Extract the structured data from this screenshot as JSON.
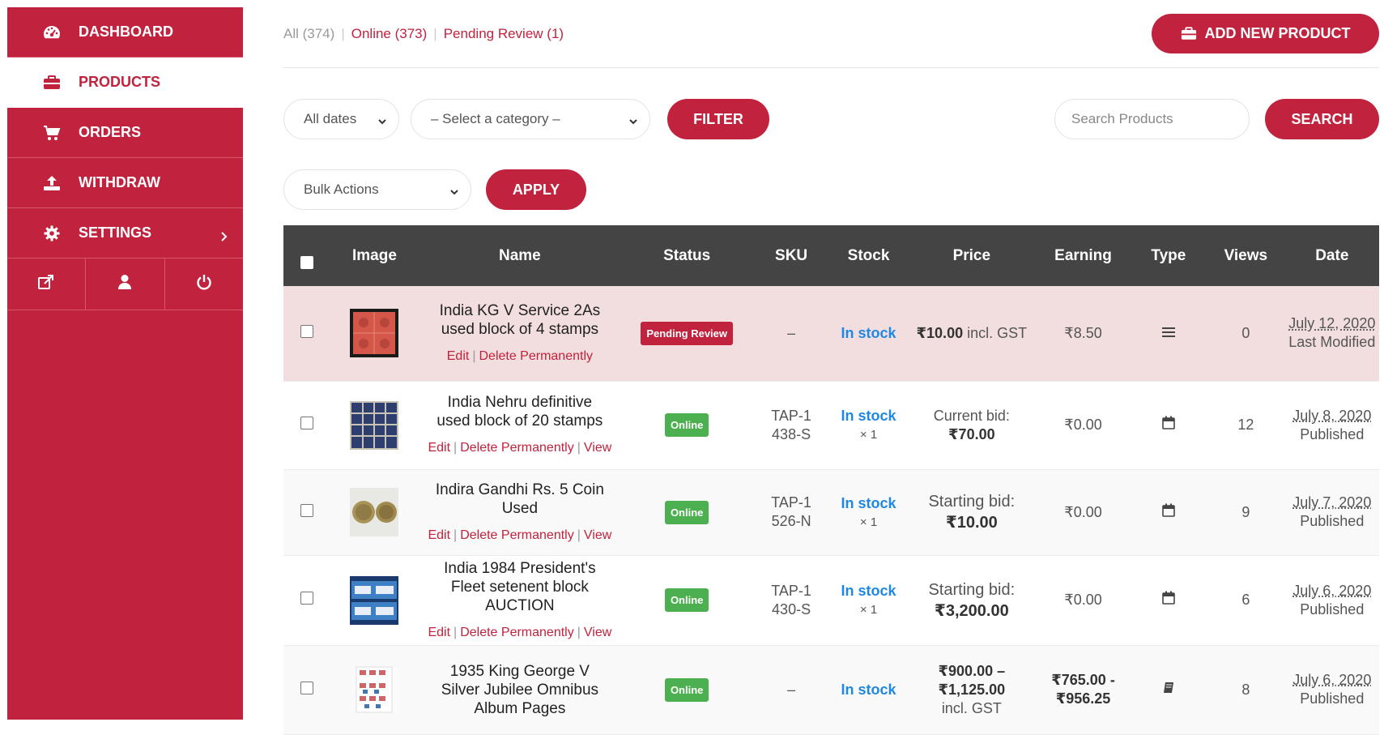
{
  "sidebar": {
    "items": [
      {
        "label": "DASHBOARD",
        "icon": "dashboard-icon"
      },
      {
        "label": "PRODUCTS",
        "icon": "briefcase-icon"
      },
      {
        "label": "ORDERS",
        "icon": "cart-icon"
      },
      {
        "label": "WITHDRAW",
        "icon": "upload-icon"
      },
      {
        "label": "SETTINGS",
        "icon": "gear-icon"
      }
    ],
    "bottom_icons": [
      "external-link-icon",
      "user-icon",
      "power-icon"
    ]
  },
  "status_tabs": {
    "all": "All (374)",
    "online": "Online (373)",
    "pending": "Pending Review (1)"
  },
  "add_button": "ADD NEW PRODUCT",
  "filters": {
    "dates": "All dates",
    "category": "– Select a category –",
    "filter_btn": "FILTER",
    "search_placeholder": "Search Products",
    "search_btn": "SEARCH",
    "bulk": "Bulk Actions",
    "apply_btn": "APPLY"
  },
  "table": {
    "headers": [
      "Image",
      "Name",
      "Status",
      "SKU",
      "Stock",
      "Price",
      "Earning",
      "Type",
      "Views",
      "Date"
    ],
    "rows": [
      {
        "name": "India KG V Service 2As used block of 4 stamps",
        "actions": [
          "Edit",
          "Delete Permanently"
        ],
        "status": "Pending Review",
        "sku": "–",
        "stock": "In stock",
        "qty": "",
        "price_bold": "₹10.00",
        "price_rest": " incl. GST",
        "earning": "₹8.50",
        "type_icon": "menu-icon",
        "views": "0",
        "date": "July 12, 2020",
        "date_note": "Last Modified"
      },
      {
        "name": "India Nehru definitive used block of 20 stamps",
        "actions": [
          "Edit",
          "Delete Permanently",
          "View"
        ],
        "status": "Online",
        "sku": "TAP-1438-S",
        "stock": "In stock",
        "qty": "× 1",
        "price_pre": "Current bid:",
        "price_bold": "₹70.00",
        "earning": "₹0.00",
        "type_icon": "calendar-icon",
        "views": "12",
        "date": "July 8, 2020",
        "date_note": "Published"
      },
      {
        "name": "Indira Gandhi Rs. 5 Coin Used",
        "actions": [
          "Edit",
          "Delete Permanently",
          "View"
        ],
        "status": "Online",
        "sku": "TAP-1526-N",
        "stock": "In stock",
        "qty": "× 1",
        "price_pre": "Starting bid:",
        "price_bold": "₹10.00",
        "earning": "₹0.00",
        "type_icon": "calendar-icon",
        "views": "9",
        "date": "July 7, 2020",
        "date_note": "Published"
      },
      {
        "name": "India 1984 President's Fleet setenent block AUCTION",
        "actions": [
          "Edit",
          "Delete Permanently",
          "View"
        ],
        "status": "Online",
        "sku": "TAP-1430-S",
        "stock": "In stock",
        "qty": "× 1",
        "price_pre": "Starting bid:",
        "price_bold": "₹3,200.00",
        "earning": "₹0.00",
        "type_icon": "calendar-icon",
        "views": "6",
        "date": "July 6, 2020",
        "date_note": "Published"
      },
      {
        "name": "1935 King George V Silver Jubilee Omnibus Album Pages",
        "actions": [],
        "status": "Online",
        "sku": "–",
        "stock": "In stock",
        "qty": "",
        "price_bold": "₹900.00 – ₹1,125.00",
        "price_rest": "incl. GST",
        "earning": "₹765.00 - ₹956.25",
        "type_icon": "book-icon",
        "views": "8",
        "date": "July 6, 2020",
        "date_note": "Published"
      }
    ]
  },
  "colors": {
    "brand": "#c1223d",
    "header": "#444444",
    "online": "#4caf50",
    "stock": "#1e88e5"
  }
}
